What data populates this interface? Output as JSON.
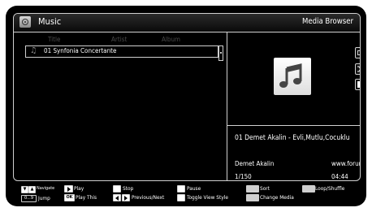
{
  "header": {
    "title": "Music",
    "browser_label": "Media Browser",
    "icon": "music-app-icon"
  },
  "list": {
    "columns": [
      "Title",
      "Artist",
      "Album"
    ],
    "items": [
      {
        "label": "01 Synfonia Concertante",
        "icon": "music-note-icon"
      }
    ]
  },
  "now_playing": {
    "album_art_icon": "music-note-icon",
    "track_title": "01 Demet Akalin - Evli,Mutlu,Cocuklu",
    "artist": "Demet Akalin",
    "url": "www.forumi...",
    "position": "1/150",
    "duration": "04:44"
  },
  "side_buttons": [
    "list-view-icon",
    "shuffle-icon",
    "stop-icon"
  ],
  "footer": {
    "navigate": "Navigate",
    "jump_key": "0...9",
    "jump": "Jump",
    "play": "Play",
    "ok_key": "OK",
    "play_this": "Play This",
    "stop": "Stop",
    "prev_next": "Previous/Next",
    "pause": "Pause",
    "toggle_view": "Toggle View Style",
    "sort": "Sort",
    "change_media": "Change Media",
    "loop_shuffle": "Loop/Shuffle"
  }
}
